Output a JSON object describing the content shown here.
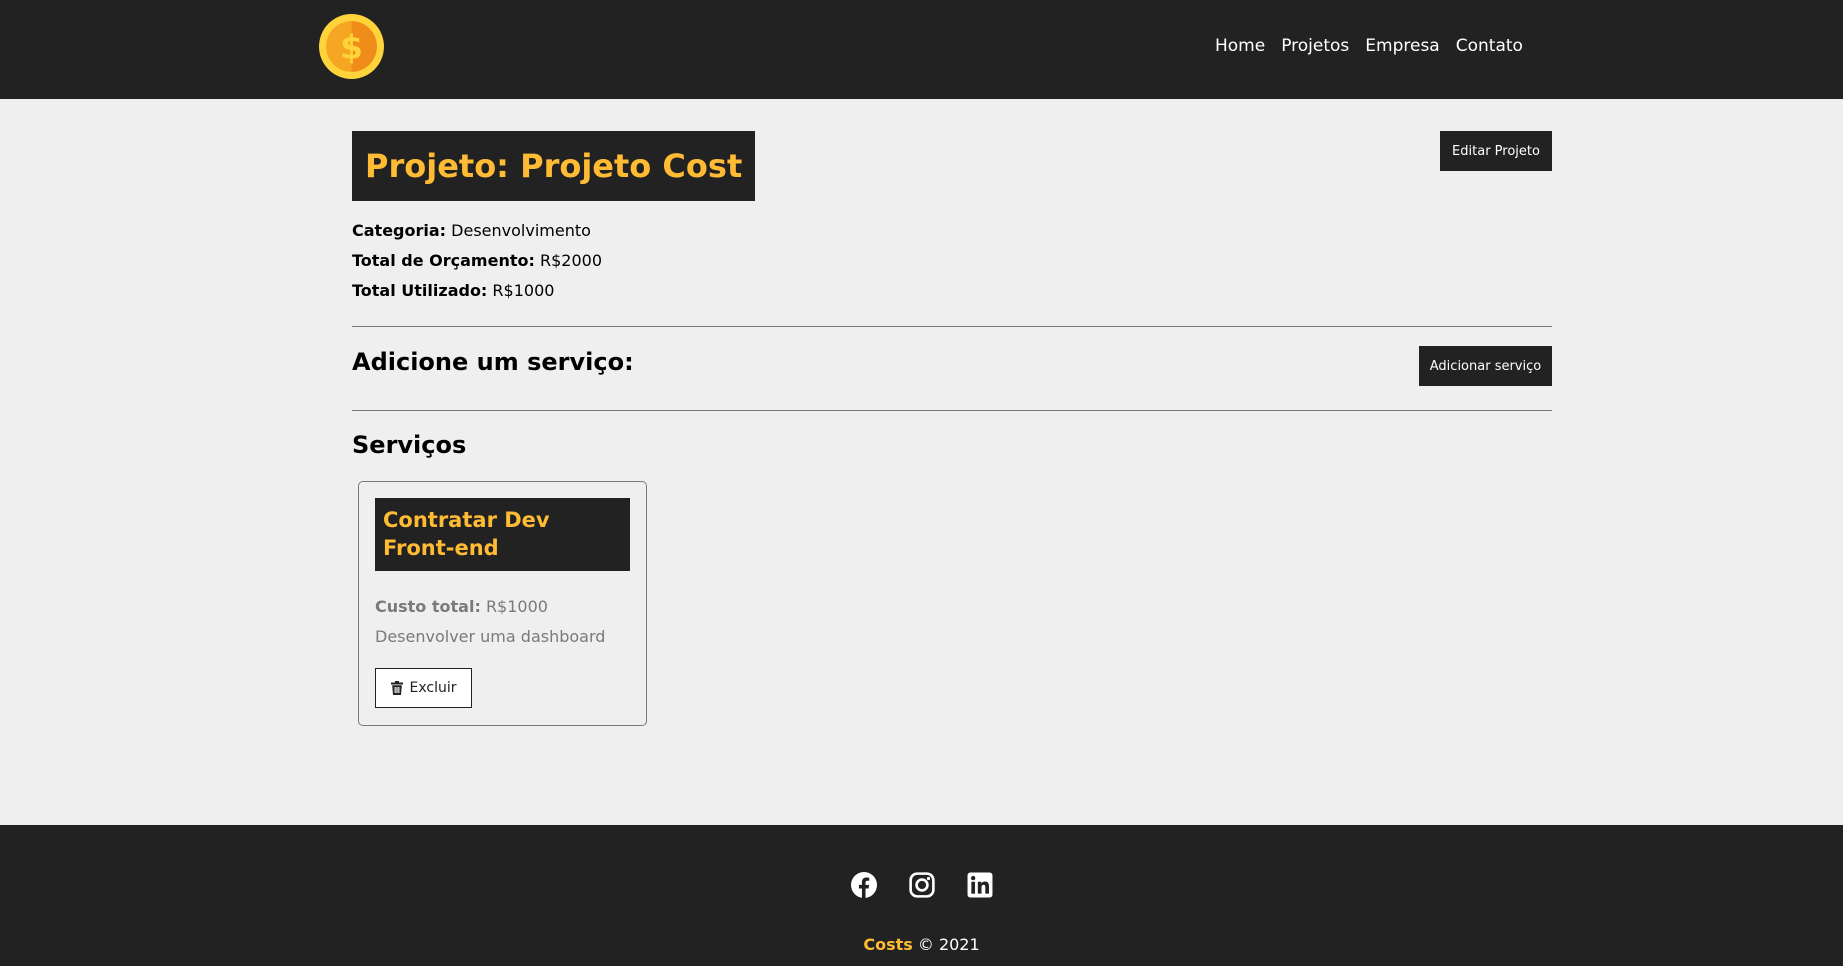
{
  "colors": {
    "dark": "#222222",
    "accent": "#ffbb33",
    "background": "#efefef",
    "muted": "#7a7a7a"
  },
  "navbar": {
    "logo_icon": "dollar-coin-icon",
    "links": [
      "Home",
      "Projetos",
      "Empresa",
      "Contato"
    ]
  },
  "project": {
    "title": "Projeto: Projeto Cost",
    "edit_button": "Editar Projeto",
    "info": [
      {
        "label": "Categoria:",
        "value": "Desenvolvimento"
      },
      {
        "label": "Total de Orçamento:",
        "value": "R$2000"
      },
      {
        "label": "Total Utilizado:",
        "value": "R$1000"
      }
    ]
  },
  "add_service": {
    "heading": "Adicione um serviço:",
    "button": "Adicionar serviço"
  },
  "services": {
    "heading": "Serviços",
    "items": [
      {
        "title": "Contratar Dev Front-end",
        "cost_label": "Custo total:",
        "cost_value": "R$1000",
        "description": "Desenvolver uma dashboard",
        "delete_button": "Excluir",
        "delete_icon": "trash-icon"
      }
    ]
  },
  "footer": {
    "social_icons": [
      "facebook-icon",
      "instagram-icon",
      "linkedin-icon"
    ],
    "brand": "Costs",
    "copyright": "© 2021"
  }
}
